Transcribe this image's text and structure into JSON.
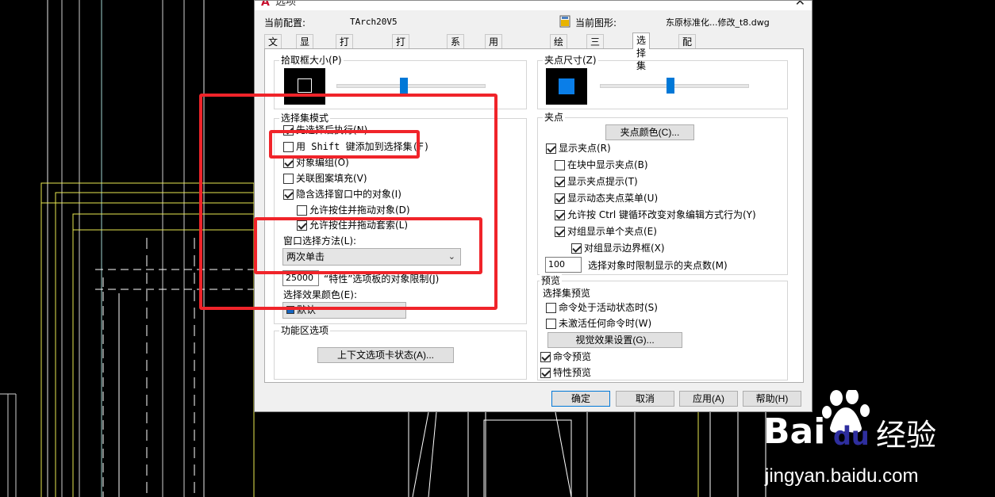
{
  "dialog": {
    "title": "选项",
    "current_profile_label": "当前配置:",
    "current_profile_value": "TArch20V5",
    "current_drawing_label": "当前图形:",
    "current_drawing_value": "东原标准化...修改_t8.dwg"
  },
  "tabs": [
    {
      "label": "文件"
    },
    {
      "label": "显示"
    },
    {
      "label": "打开和保存"
    },
    {
      "label": "打印和发布"
    },
    {
      "label": "系统"
    },
    {
      "label": "用户系统配置"
    },
    {
      "label": "绘图"
    },
    {
      "label": "三维建模"
    },
    {
      "label": "选择集"
    },
    {
      "label": "配置"
    }
  ],
  "active_tab": "选择集",
  "pickbox": {
    "title": "拾取框大小(P)",
    "level": 0.45
  },
  "grip_size": {
    "title": "夹点尺寸(Z)",
    "level": 0.47
  },
  "selection_modes": {
    "title": "选择集模式",
    "items": [
      {
        "label": "先选择后执行(N)",
        "checked": true
      },
      {
        "label": "用 Shift 键添加到选择集(F)",
        "checked": false
      },
      {
        "label": "对象编组(O)",
        "checked": true
      },
      {
        "label": "关联图案填充(V)",
        "checked": false
      },
      {
        "label": "隐含选择窗口中的对象(I)",
        "checked": true
      },
      {
        "label": "允许按住并拖动对象(D)",
        "checked": false
      },
      {
        "label": "允许按住并拖动套索(L)",
        "checked": true
      }
    ],
    "window_method_label": "窗口选择方法(L):",
    "window_method_value": "两次单击",
    "limit_value": "25000",
    "limit_label": "“特性”选项板的对象限制(J)",
    "effect_color_label": "选择效果颜色(E):",
    "effect_color_value": "默认",
    "effect_color_hex": "#1565c0"
  },
  "ribbon": {
    "title": "功能区选项",
    "button_label": "上下文选项卡状态(A)..."
  },
  "grips": {
    "title": "夹点",
    "color_button": "夹点颜色(C)...",
    "items": [
      {
        "label": "显示夹点(R)",
        "checked": true
      },
      {
        "label": "在块中显示夹点(B)",
        "checked": false
      },
      {
        "label": "显示夹点提示(T)",
        "checked": true
      },
      {
        "label": "显示动态夹点菜单(U)",
        "checked": true
      },
      {
        "label": "允许按 Ctrl 键循环改变对象编辑方式行为(Y)",
        "checked": true
      },
      {
        "label": "对组显示单个夹点(E)",
        "checked": true
      },
      {
        "label": "对组显示边界框(X)",
        "checked": true
      }
    ],
    "limit_value": "100",
    "limit_label": "选择对象时限制显示的夹点数(M)"
  },
  "preview": {
    "title": "预览",
    "subtitle": "选择集预览",
    "items": [
      {
        "label": "命令处于活动状态时(S)",
        "checked": false
      },
      {
        "label": "未激活任何命令时(W)",
        "checked": false
      }
    ],
    "visual_button": "视觉效果设置(G)...",
    "cmd_preview": {
      "label": "命令预览",
      "checked": true
    },
    "prop_preview": {
      "label": "特性预览",
      "checked": true
    }
  },
  "footer": {
    "ok": "确定",
    "cancel": "取消",
    "apply": "应用(A)",
    "help": "帮助(H)"
  },
  "watermark": {
    "brand": "Bai",
    "brand_tail": "du",
    "suffix": "经验",
    "url": "jingyan.baidu.com"
  },
  "colors": {
    "accent": "#0078d7",
    "highlight": "#f0242a"
  }
}
